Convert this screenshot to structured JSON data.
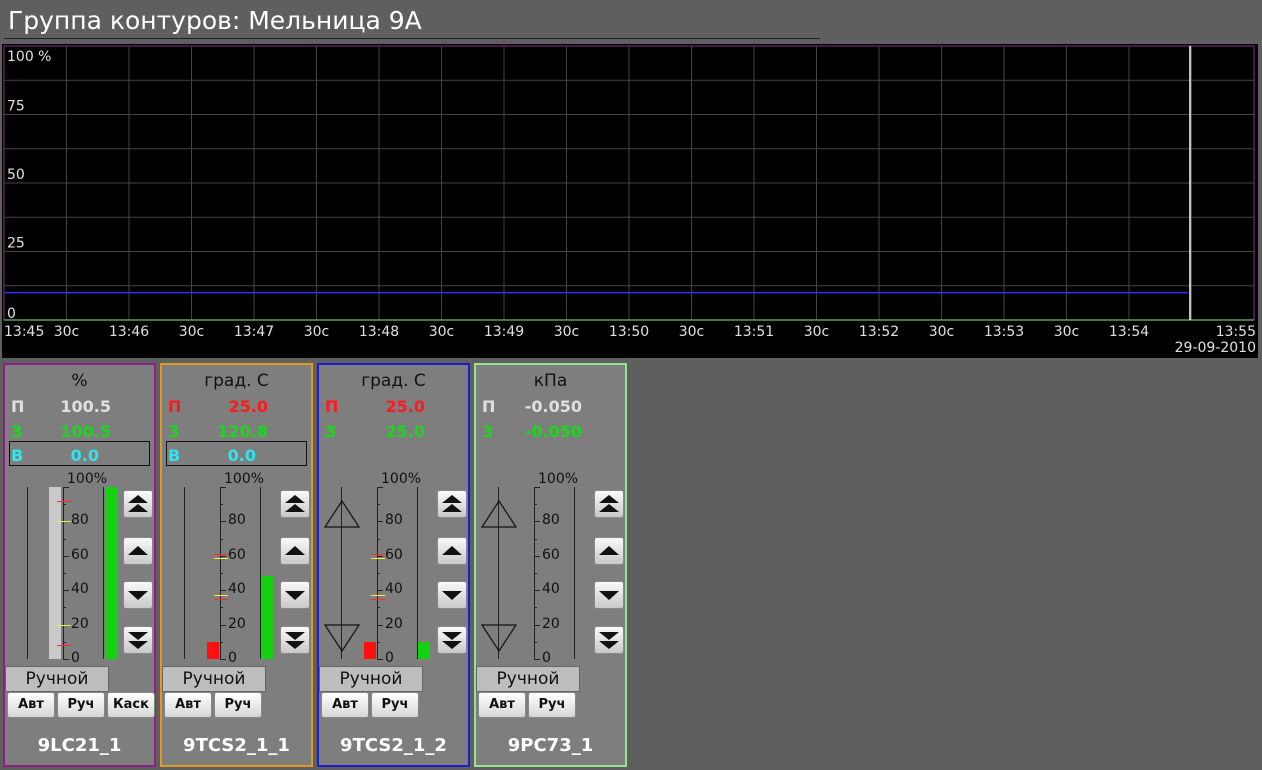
{
  "window": {
    "title": "Группа контуров: Мельница 9А"
  },
  "chart_data": {
    "type": "line",
    "ylabels": [
      "100 %",
      "75",
      "50",
      "25",
      "0"
    ],
    "xlabels": [
      "13:45",
      "30с",
      "13:46",
      "30с",
      "13:47",
      "30с",
      "13:48",
      "30с",
      "13:49",
      "30с",
      "13:50",
      "30с",
      "13:51",
      "30с",
      "13:52",
      "30с",
      "13:53",
      "30с",
      "13:54",
      "13:55"
    ],
    "date": "29-09-2010",
    "ylim": [
      0,
      100
    ],
    "series": [
      {
        "color": "#2f2fff",
        "values": [
          10,
          10
        ]
      }
    ],
    "cursor_time": "13:54:30"
  },
  "controllers": [
    {
      "id": "9LC21_1",
      "unit": "%",
      "frame_color": "#8d1f8d",
      "labels": {
        "p": "П",
        "z": "З",
        "v": "В"
      },
      "p_value": "100.5",
      "z_value": "100.5",
      "v_value": "0.0",
      "p_color": "#e0e0e0",
      "z_color": "#1fd61f",
      "v_color": "#2ee6ee",
      "scale": [
        "100%",
        "80",
        "60",
        "40",
        "20",
        "0"
      ],
      "mode_button": "Ручной",
      "buttons": [
        "Авт",
        "Руч",
        "Каск"
      ],
      "pv_percent": 100.5,
      "out_percent": 0,
      "sp_percent": 100
    },
    {
      "id": "9TCS2_1_1",
      "unit": "град. С",
      "frame_color": "#e09a20",
      "labels": {
        "p": "П",
        "z": "З",
        "v": "В"
      },
      "p_value": "25.0",
      "z_value": "120.8",
      "v_value": "0.0",
      "p_color": "#ff1a1a",
      "z_color": "#1fd61f",
      "v_color": "#2ee6ee",
      "scale": [
        "100%",
        "80",
        "60",
        "40",
        "20",
        "0"
      ],
      "mode_button": "Ручной",
      "buttons": [
        "Авт",
        "Руч"
      ],
      "pv_percent": 10,
      "out_percent": 0,
      "sp_percent": 48
    },
    {
      "id": "9TCS2_1_2",
      "unit": "град. С",
      "frame_color": "#1c1cd0",
      "labels": {
        "p": "П",
        "z": "З"
      },
      "p_value": "25.0",
      "z_value": "25.0",
      "p_color": "#ff1a1a",
      "z_color": "#1fd61f",
      "scale": [
        "100%",
        "80",
        "60",
        "40",
        "20",
        "0"
      ],
      "mode_button": "Ручной",
      "buttons": [
        "Авт",
        "Руч"
      ],
      "pv_percent": 10,
      "out_percent": 0,
      "sp_percent": 10
    },
    {
      "id": "9PC73_1",
      "unit": "кПа",
      "frame_color": "#8fe68f",
      "labels": {
        "p": "П",
        "z": "З"
      },
      "p_value": "-0.050",
      "z_value": "-0.050",
      "p_color": "#e0e0e0",
      "z_color": "#1fd61f",
      "scale": [
        "100%",
        "80",
        "60",
        "40",
        "20",
        "0"
      ],
      "mode_button": "Ручной",
      "buttons": [
        "Авт",
        "Руч"
      ],
      "pv_percent": 0,
      "out_percent": 0,
      "sp_percent": 0
    }
  ]
}
